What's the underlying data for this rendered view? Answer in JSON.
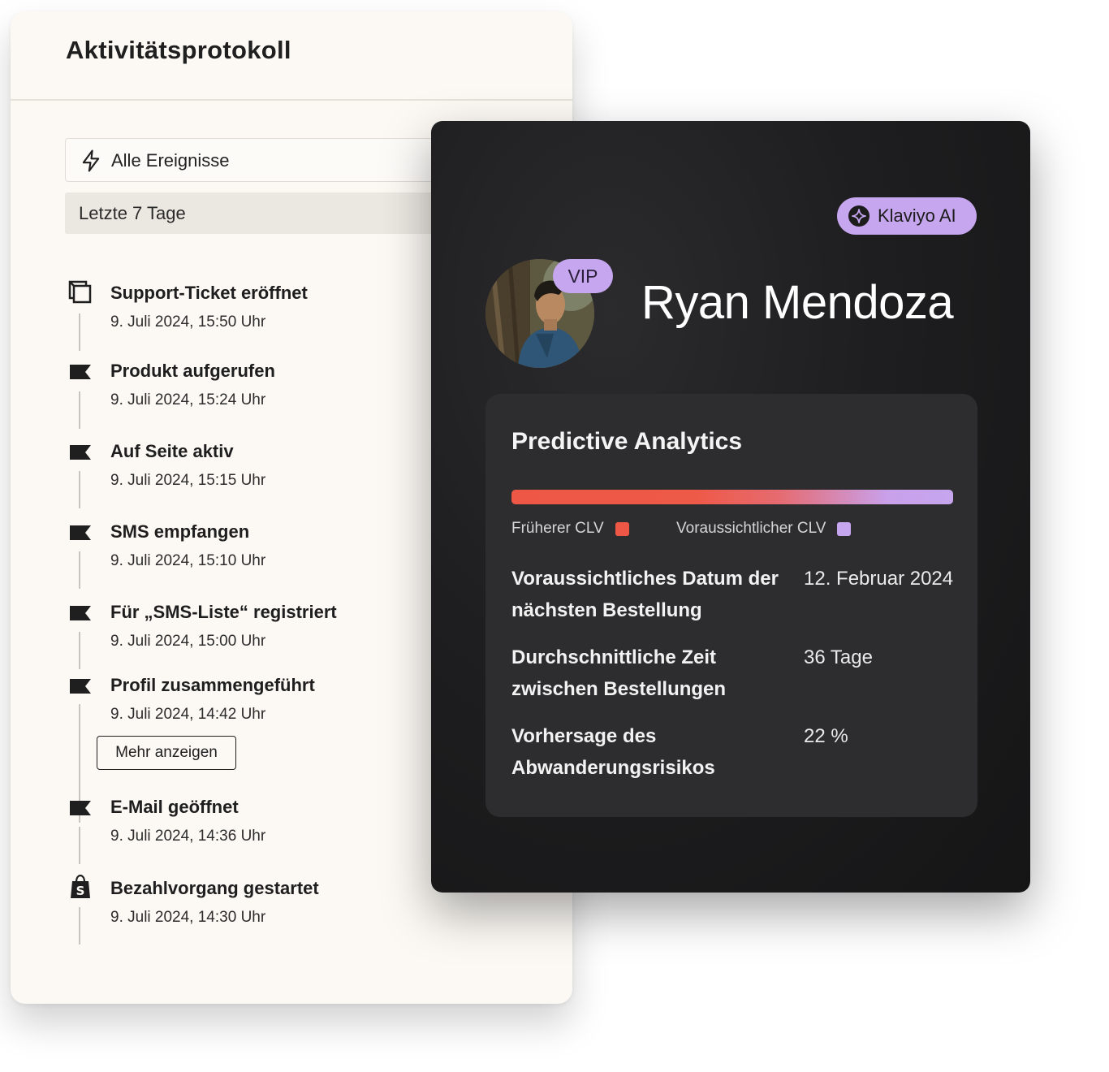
{
  "activity_log": {
    "title": "Aktivitätsprotokoll",
    "filter_events_label": "Alle Ereignisse",
    "filter_range_label": "Letzte 7 Tage",
    "show_more_label": "Mehr anzeigen",
    "events": [
      {
        "title": "Support-Ticket eröffnet",
        "time": "9. Juli 2024, 15:50 Uhr",
        "icon": "support-ticket-icon"
      },
      {
        "title": "Produkt aufgerufen",
        "time": "9. Juli 2024, 15:24 Uhr",
        "icon": "flag-icon"
      },
      {
        "title": "Auf Seite aktiv",
        "time": "9. Juli 2024, 15:15 Uhr",
        "icon": "flag-icon"
      },
      {
        "title": "SMS empfangen",
        "time": "9. Juli 2024, 15:10 Uhr",
        "icon": "flag-icon"
      },
      {
        "title": "Für „SMS-Liste“ registriert",
        "time": "9. Juli 2024, 15:00 Uhr",
        "icon": "flag-icon"
      },
      {
        "title": "Profil zusammengeführt",
        "time": "9. Juli 2024, 14:42 Uhr",
        "icon": "flag-icon"
      },
      {
        "title": "E-Mail geöffnet",
        "time": "9. Juli 2024, 14:36 Uhr",
        "icon": "flag-icon"
      },
      {
        "title": "Bezahlvorgang gestartet",
        "time": "9. Juli 2024, 14:30 Uhr",
        "icon": "shopify-bag-icon"
      }
    ]
  },
  "profile": {
    "ai_badge_label": "Klaviyo AI",
    "vip_label": "VIP",
    "name": "Ryan Mendoza",
    "analytics": {
      "title": "Predictive Analytics",
      "legend_past": "Früherer CLV",
      "legend_predicted": "Voraussichtlicher CLV",
      "metrics": [
        {
          "label": "Voraussichtliches Datum der nächsten Bestellung",
          "value": "12. Februar 2024"
        },
        {
          "label": "Durchschnittliche Zeit zwischen Bestellungen",
          "value": "36 Tage"
        },
        {
          "label": "Vorhersage des Abwanderungsrisikos",
          "value": "22 %"
        }
      ]
    }
  },
  "colors": {
    "accent_purple": "#c6a6ef",
    "accent_red": "#ee5745",
    "card_light": "#fcf9f4",
    "card_dark": "#1e1e20",
    "panel_dark": "#2d2d2f"
  }
}
